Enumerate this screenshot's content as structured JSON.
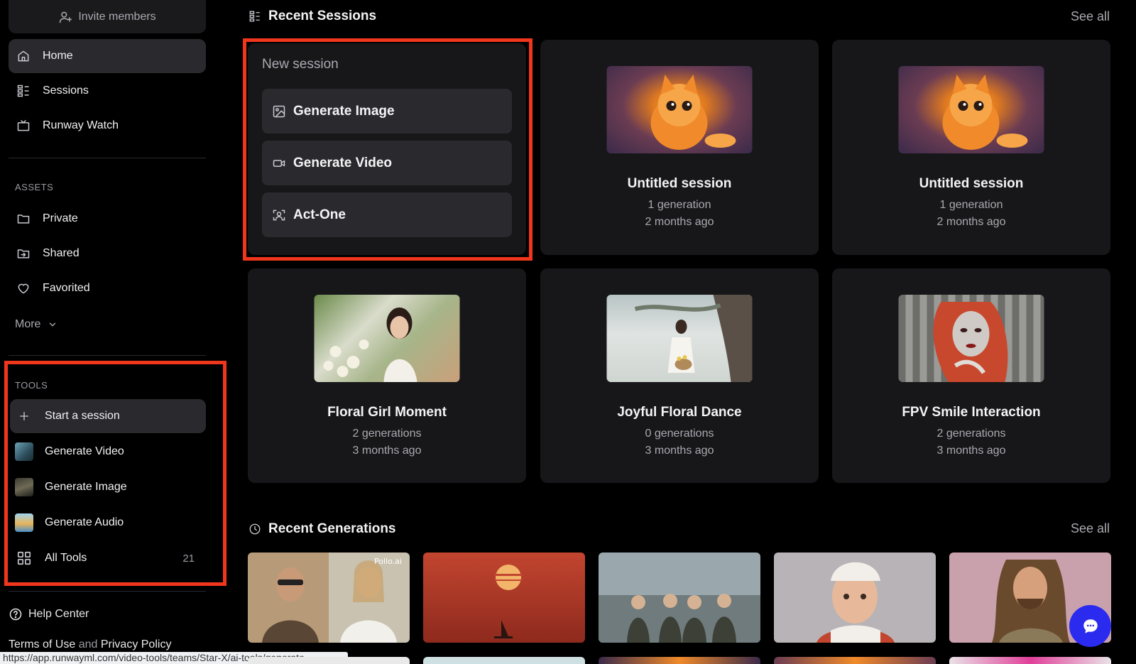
{
  "sidebar": {
    "invite_label": "Invite members",
    "nav": [
      {
        "label": "Home",
        "icon": "home-icon"
      },
      {
        "label": "Sessions",
        "icon": "sessions-icon"
      },
      {
        "label": "Runway Watch",
        "icon": "tv-icon"
      }
    ],
    "assets_label": "ASSETS",
    "assets": [
      {
        "label": "Private",
        "icon": "folder-icon"
      },
      {
        "label": "Shared",
        "icon": "shared-folder-icon"
      },
      {
        "label": "Favorited",
        "icon": "heart-icon"
      }
    ],
    "more_label": "More",
    "tools_label": "TOOLS",
    "tools": [
      {
        "label": "Start a session",
        "icon": "plus-icon"
      },
      {
        "label": "Generate Video",
        "icon": "generate-video-thumb"
      },
      {
        "label": "Generate Image",
        "icon": "generate-image-thumb"
      },
      {
        "label": "Generate Audio",
        "icon": "generate-audio-thumb"
      },
      {
        "label": "All Tools",
        "icon": "grid-icon",
        "count": "21"
      }
    ],
    "help_label": "Help Center",
    "terms_label": "Terms of Use",
    "and_label": "and",
    "privacy_label": "Privacy Policy"
  },
  "status_url": "https://app.runwayml.com/video-tools/teams/Star-X/ai-tools/generate",
  "recent_sessions": {
    "title": "Recent Sessions",
    "see_all": "See all",
    "new_session": {
      "label": "New session",
      "buttons": [
        {
          "label": "Generate Image",
          "icon": "image-icon"
        },
        {
          "label": "Generate Video",
          "icon": "video-camera-icon"
        },
        {
          "label": "Act-One",
          "icon": "face-scan-icon"
        }
      ]
    },
    "sessions": [
      {
        "title": "Untitled session",
        "generations": "1 generation",
        "age": "2 months ago"
      },
      {
        "title": "Untitled session",
        "generations": "1 generation",
        "age": "2 months ago"
      },
      {
        "title": "Floral Girl Moment",
        "generations": "2 generations",
        "age": "3 months ago"
      },
      {
        "title": "Joyful Floral Dance",
        "generations": "0 generations",
        "age": "3 months ago"
      },
      {
        "title": "FPV Smile Interaction",
        "generations": "2 generations",
        "age": "3 months ago"
      }
    ]
  },
  "recent_generations": {
    "title": "Recent Generations",
    "see_all": "See all",
    "watermark": "Pollo.ai"
  },
  "colors": {
    "highlight": "#f0361d",
    "chat_button": "#2b2bf0",
    "card_bg": "#17171a"
  }
}
